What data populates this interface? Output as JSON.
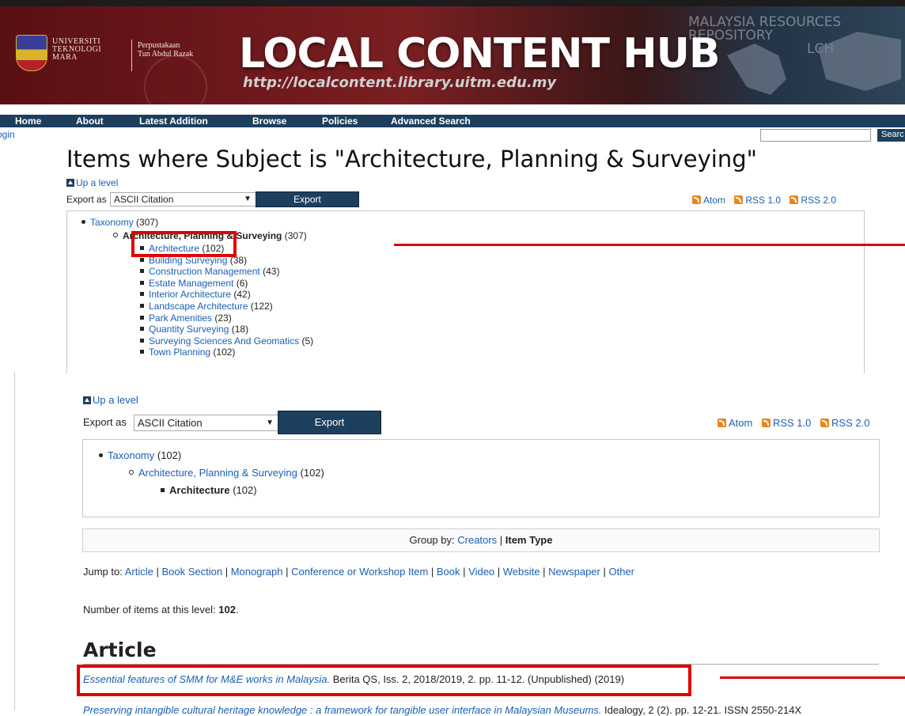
{
  "banner": {
    "uni_lines": [
      "UNIVERSITI",
      "TEKNOLOGI",
      "MARA"
    ],
    "lib_lines": [
      "Perpustakaan",
      "Tun Abdul Razak"
    ],
    "title": "LOCAL CONTENT HUB",
    "url": "http://localcontent.library.uitm.edu.my",
    "watermark": "MALAYSIA RESOURCES REPOSITORY",
    "watermark_sub": "LCH"
  },
  "nav": {
    "items": [
      "Home",
      "About",
      "Latest Addition",
      "Browse",
      "Policies",
      "Advanced Search"
    ],
    "login": "ogin",
    "search_button": "Searc"
  },
  "page": {
    "title": "Items where Subject is \"Architecture, Planning & Surveying\""
  },
  "top": {
    "up_level": "Up a level",
    "export_label": "Export as",
    "export_option": "ASCII Citation",
    "export_button": "Export",
    "feeds": [
      "Atom",
      "RSS 1.0",
      "RSS 2.0"
    ],
    "taxonomy": {
      "label": "Taxonomy",
      "count": "(307)"
    },
    "parent": {
      "label": "Architecture, Planning & Surveying",
      "count": "(307)"
    },
    "children": [
      {
        "label": "Architecture",
        "count": "(102)"
      },
      {
        "label": "Building Surveying",
        "count": "(38)"
      },
      {
        "label": "Construction Management",
        "count": "(43)"
      },
      {
        "label": "Estate Management",
        "count": "(6)"
      },
      {
        "label": "Interior Architecture",
        "count": "(42)"
      },
      {
        "label": "Landscape Architecture",
        "count": "(122)"
      },
      {
        "label": "Park Amenities",
        "count": "(23)"
      },
      {
        "label": "Quantity Surveying",
        "count": "(18)"
      },
      {
        "label": "Surveying Sciences And Geomatics",
        "count": "(5)"
      },
      {
        "label": "Town Planning",
        "count": "(102)"
      }
    ]
  },
  "bottom": {
    "up_level": "Up a level",
    "export_label": "Export as",
    "export_option": "ASCII Citation",
    "export_button": "Export",
    "feeds": [
      "Atom",
      "RSS 1.0",
      "RSS 2.0"
    ],
    "taxonomy": {
      "label": "Taxonomy",
      "count": "(102)"
    },
    "parent": {
      "label": "Architecture, Planning & Surveying",
      "count": "(102)"
    },
    "current": {
      "label": "Architecture",
      "count": "(102)"
    },
    "group_by": {
      "label": "Group by:",
      "creators": "Creators",
      "sep": "|",
      "item_type": "Item Type"
    },
    "jump_to": {
      "label": "Jump to:",
      "links": [
        "Article",
        "Book Section",
        "Monograph",
        "Conference or Workshop Item",
        "Book",
        "Video",
        "Website",
        "Newspaper",
        "Other"
      ]
    },
    "num_items": {
      "label": "Number of items at this level:",
      "value": "102",
      "end": "."
    },
    "section_heading": "Article",
    "entries": [
      {
        "title": "Essential features of SMM for M&E works in Malaysia.",
        "rest": "Berita QS, Iss. 2, 2018/2019, 2. pp. 11-12. (Unpublished) (2019)"
      },
      {
        "title": "Preserving intangible cultural heritage knowledge : a framework for tangible user interface in Malaysian Museums.",
        "rest": "Idealogy, 2 (2). pp. 12-21. ISSN 2550-214X"
      }
    ]
  },
  "colors": {
    "nav_bg": "#1d3f5e",
    "link": "#1a5fb4",
    "highlight": "#e00000",
    "feed": "#e8861a"
  }
}
